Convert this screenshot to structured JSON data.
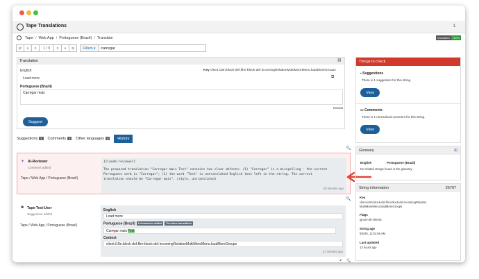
{
  "window": {
    "title": "Tape Translations",
    "menu_number": "1"
  },
  "breadcrumb": {
    "items": [
      "Tape",
      "Web App",
      "Portuguese (Brazil)",
      "Translate"
    ]
  },
  "status_badge": {
    "label": "translated",
    "value": "100%"
  },
  "toolbar": {
    "first": "|<",
    "prev": "<",
    "position": "1 / 9",
    "next": ">",
    "last": ">|",
    "filters_label": "Filters",
    "search_value": "carregar"
  },
  "translation_panel": {
    "title": "Translation",
    "source_lang": "English",
    "key_label": "Key",
    "key_value": "client.i18n.block-def.film-block-def.incomingRelationMultiMoreMenu.loadMoreGroups",
    "source_text": "Load more",
    "target_lang": "Portuguese (Brazil)",
    "target_value": "Carregar mais",
    "suggest_button": "Suggest"
  },
  "tabs": [
    {
      "label": "Suggestions",
      "count": "1"
    },
    {
      "label": "Comments",
      "count": "1"
    },
    {
      "label": "Other languages",
      "count": "0"
    },
    {
      "label": "History",
      "count": ""
    }
  ],
  "history": [
    {
      "author": "AI-Reviewer",
      "action": "Comment added",
      "breadcrumb": [
        "Tape",
        "Web App",
        "Portuguese (Brazil)"
      ],
      "comment_header": "[claude-reviewer]",
      "comment_lines": [
        "The proposed translation \"Carregar mais Test\" contains two clear defects: (1) \"Carregar\" is a misspelling - the correct",
        "Portuguese verb is \"Carregar\"; (2) the word \"Test\" is untranslated English text left in the string. The correct",
        "translation should be \"Carregar mais\". (style, untranslated)"
      ],
      "time": "20 minutes ago"
    },
    {
      "author": "Tape-Test-User",
      "action": "Suggestion added",
      "breadcrumb": [
        "Tape",
        "Web App",
        "Portuguese (Brazil)"
      ],
      "english_label": "English",
      "english_value": "Load more",
      "portuguese_label": "Portuguese (Brazil)",
      "chip1": "6 characters added",
      "chip2": "Previous translation",
      "diff_before": "Car",
      "diff_mid": "e",
      "diff_after": "gar mais ",
      "diff_added": "Test",
      "context_label": "Context",
      "context_value": "client.i18n.block-def.film-block-def.incomingRelationMultiMoreMenu.loadMoreGroups",
      "time": "21 minutes ago"
    }
  ],
  "things_to_check": {
    "title": "Things to check",
    "suggestions_title": "Suggestions",
    "suggestions_text": "There is 1 suggestion for this string.",
    "comments_title": "Comments",
    "comments_text": "There is 1 unresolved comment for this string.",
    "view_label": "View"
  },
  "glossary": {
    "title": "Glossary",
    "col1": "English",
    "col2": "Portuguese (Brazil)",
    "empty": "No related strings found in the glossary."
  },
  "string_info": {
    "title": "String information",
    "id": "26707",
    "key_label": "Key",
    "key_value_1": "client.i18n.block-def.film-block-def.incomingRelation",
    "key_value_2": "MultiMoreMenu.loadMoreGroups",
    "flags_label": "Flags",
    "flags_value": "ignore-all-checks",
    "age_label": "String age",
    "age_value": "5/5/26, 11:51:56 AM",
    "updated_label": "Last updated",
    "updated_value": "13 hours ago"
  },
  "colors": {
    "accent": "#1d5f99",
    "alert_red": "#d0392b",
    "arrow_red": "#e0453a",
    "ok_green": "#2f9a3a"
  }
}
